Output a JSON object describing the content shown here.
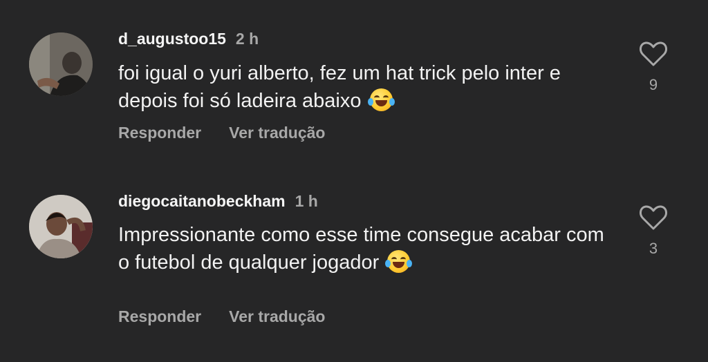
{
  "comments": [
    {
      "username": "d_augustoo15",
      "time": "2 h",
      "text": "foi igual o yuri alberto, fez um hat trick pelo inter e depois foi só ladeira abaixo",
      "emoji": "😂",
      "likes": "9",
      "reply_label": "Responder",
      "translate_label": "Ver tradução"
    },
    {
      "username": "diegocaitanobeckham",
      "time": "1 h",
      "text": "Impressionante como esse time consegue acabar com o futebol de qualquer jogador",
      "emoji": "😂",
      "likes": "3",
      "reply_label": "Responder",
      "translate_label": "Ver tradução"
    }
  ],
  "colors": {
    "background": "#262627",
    "primary_text": "#f2f2f2",
    "secondary_text": "#a8a8a8"
  },
  "icons": [
    "avatar",
    "laughing-emoji-icon",
    "heart-icon"
  ]
}
